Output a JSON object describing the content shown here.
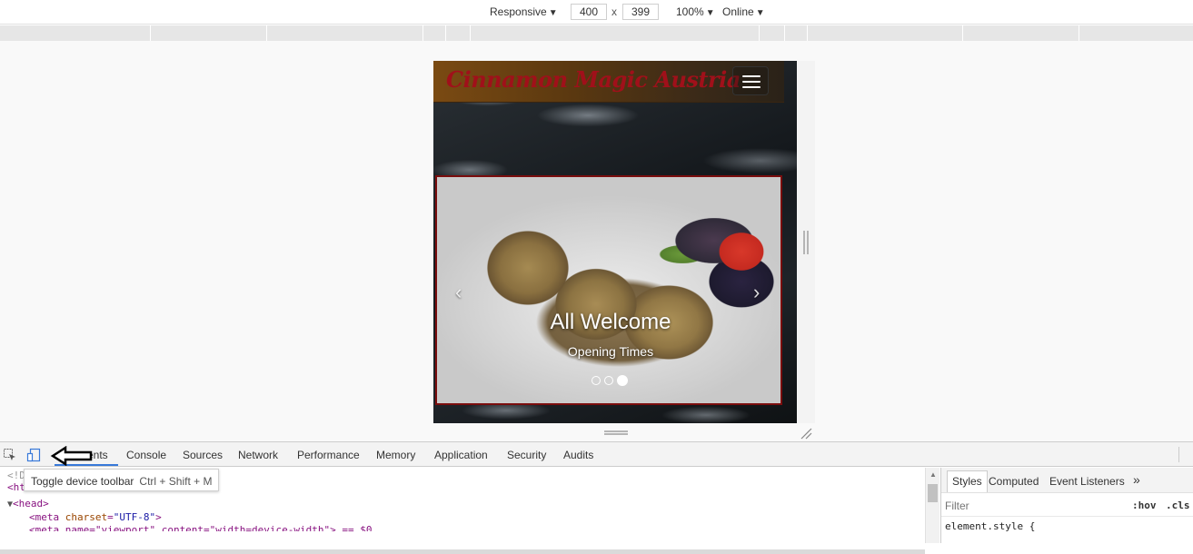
{
  "device_toolbar": {
    "device": "Responsive",
    "width": "400",
    "height": "399",
    "dimension_separator": "x",
    "zoom": "100%",
    "throttling": "Online",
    "dropdown_arrow": "▼"
  },
  "page": {
    "brand": "Cinnamon Magic Austria",
    "carousel": {
      "title": "All Welcome",
      "subtitle": "Opening Times",
      "prev_glyph": "‹",
      "next_glyph": "›",
      "slide_count": 3,
      "active_slide": 3
    }
  },
  "devtools": {
    "tabs": [
      {
        "label": "Elements",
        "selected": true
      },
      {
        "label": "Console"
      },
      {
        "label": "Sources"
      },
      {
        "label": "Network"
      },
      {
        "label": "Performance"
      },
      {
        "label": "Memory"
      },
      {
        "label": "Application"
      },
      {
        "label": "Security"
      },
      {
        "label": "Audits"
      }
    ],
    "elements_visible_fragment": "ents",
    "tooltip": {
      "label": "Toggle device toolbar",
      "shortcut": "Ctrl + Shift + M"
    },
    "code": {
      "line1": "<!D",
      "line2": "<html>",
      "head_tag": "<head>",
      "meta_open": "<meta ",
      "meta_attr": "charset",
      "meta_eq": "=",
      "meta_val": "\"UTF-8\"",
      "meta_close": ">",
      "line5": "<meta name=\"viewport\" content=\"width=device-width\"> == $0"
    },
    "styles": {
      "tabs": [
        "Styles",
        "Computed",
        "Event Listeners"
      ],
      "more": "»",
      "filter_placeholder": "Filter",
      "hov": ":hov",
      "cls": ".cls",
      "element_style": "element.style {"
    }
  }
}
